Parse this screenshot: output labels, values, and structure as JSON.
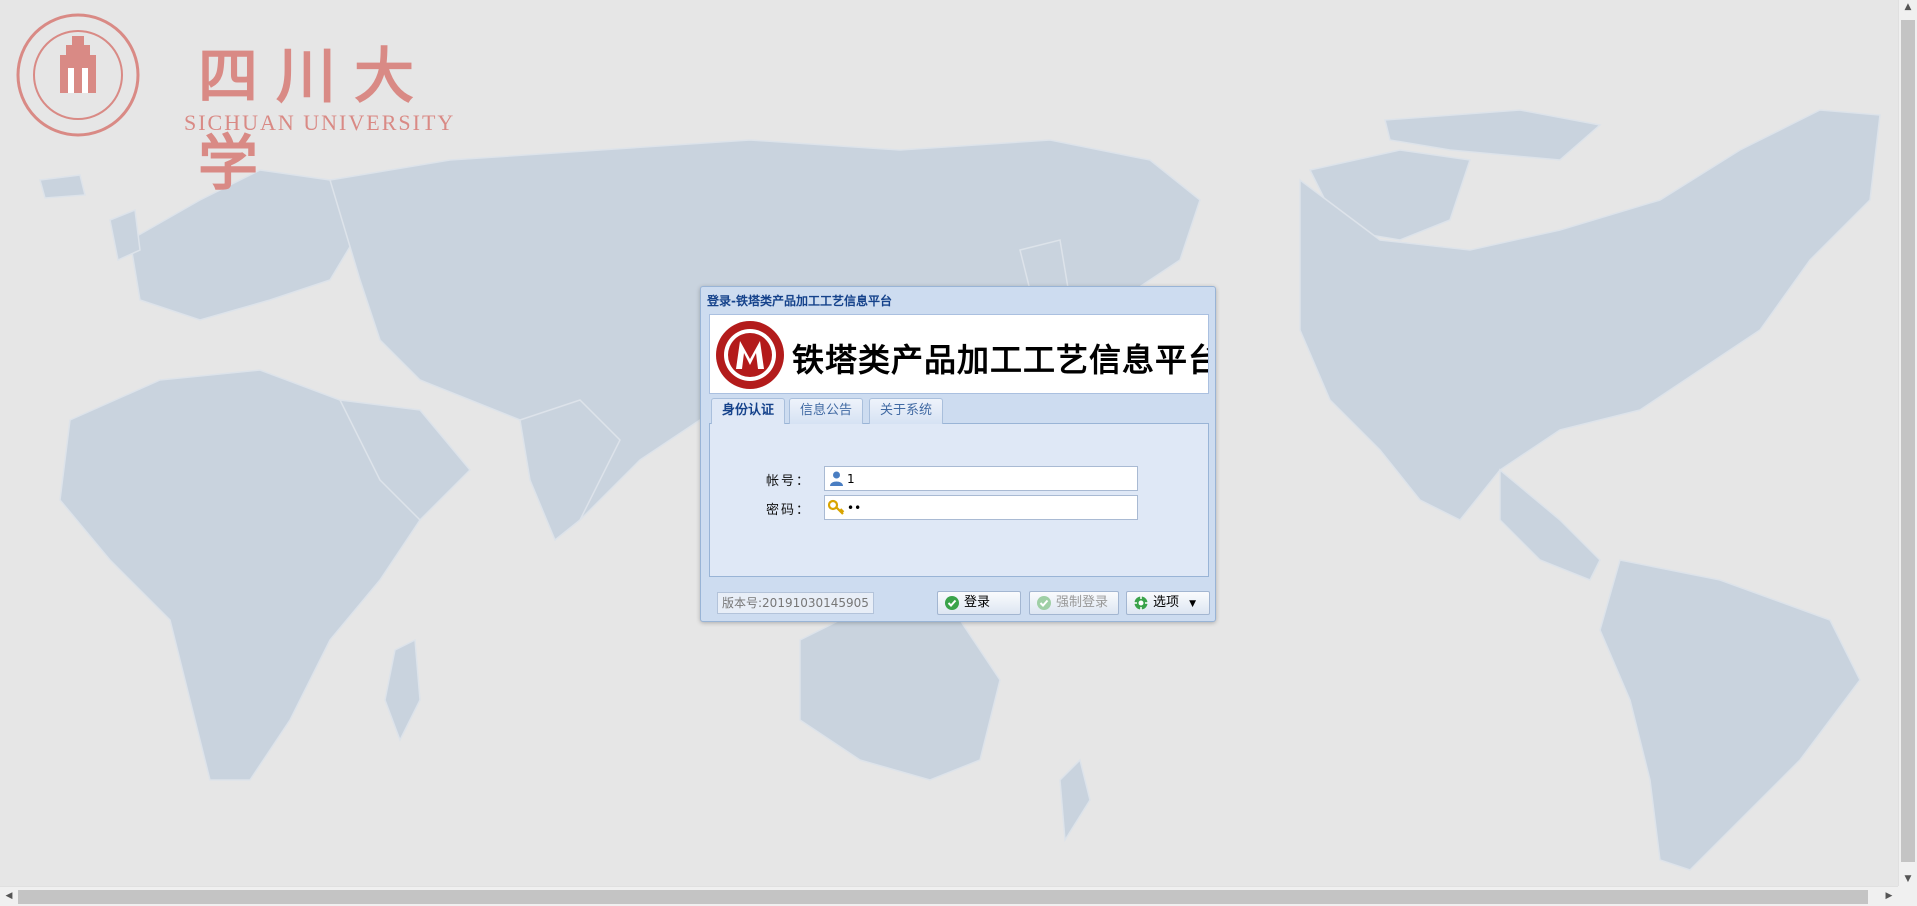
{
  "background": {
    "color": "#e6e6e6",
    "map_color": "#c9d3de"
  },
  "university": {
    "name_cn": "四川大学",
    "name_en": "SICHUAN UNIVERSITY",
    "seal_icon": "sichuan-university-seal",
    "color": "#d98a85"
  },
  "login_window": {
    "title": "登录-铁塔类产品加工工艺信息平台",
    "banner_title": "铁塔类产品加工工艺信息平台",
    "banner_logo_icon": "platform-logo",
    "tabs": [
      {
        "label": "身份认证",
        "active": true
      },
      {
        "label": "信息公告",
        "active": false
      },
      {
        "label": "关于系统",
        "active": false
      }
    ],
    "form": {
      "account_label": "帐号：",
      "account_value": "1",
      "account_icon": "user-icon",
      "password_label": "密码：",
      "password_value": "11",
      "password_icon": "key-icon"
    },
    "version": "版本号:20191030145905",
    "buttons": {
      "login": "登录",
      "force_login": "强制登录",
      "options": "选项"
    }
  },
  "colors": {
    "window_bg": "#cddcf0",
    "title_text": "#15428b",
    "tab_text": "#416aa3",
    "panel_bg": "#dfe8f6"
  }
}
